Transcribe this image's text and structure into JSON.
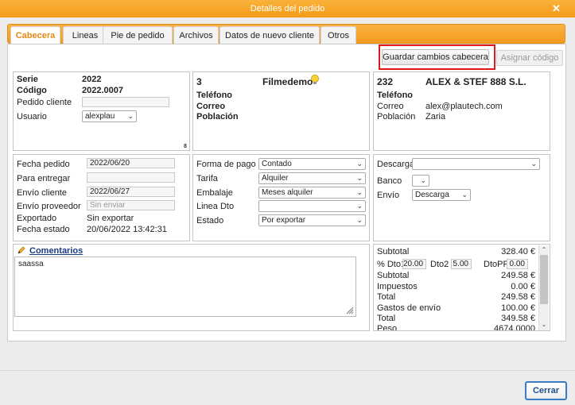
{
  "window": {
    "title": "Detalles del pedido"
  },
  "tabs": [
    {
      "label": "Cabecera"
    },
    {
      "label": "Lineas"
    },
    {
      "label": "Pie de pedido"
    },
    {
      "label": "Archivos"
    },
    {
      "label": "Datos de nuevo cliente"
    },
    {
      "label": "Otros"
    }
  ],
  "toolbar": {
    "save_label": "Guardar cambios cabecera",
    "assign_label": "Asignar código"
  },
  "header": {
    "serie_label": "Serie",
    "serie_value": "2022",
    "codigo_label": "Código",
    "codigo_value": "2022.0007",
    "pedido_cliente_label": "Pedido cliente",
    "pedido_cliente_value": "",
    "usuario_label": "Usuario",
    "usuario_value": "alexplau",
    "corner_num": "8"
  },
  "store": {
    "num": "3",
    "name": "Filmedemo",
    "telefono_label": "Teléfono",
    "correo_label": "Correo",
    "poblacion_label": "Población"
  },
  "customer": {
    "num": "232",
    "name": "ALEX & STEF 888 S.L.",
    "telefono_label": "Teléfono",
    "telefono_value": "",
    "correo_label": "Correo",
    "correo_value": "alex@plautech.com",
    "poblacion_label": "Población",
    "poblacion_value": "Zaria"
  },
  "dates": {
    "fecha_pedido_label": "Fecha pedido",
    "fecha_pedido_value": "2022/06/20",
    "para_entregar_label": "Para entregar",
    "para_entregar_value": "",
    "envio_cliente_label": "Envío cliente",
    "envio_cliente_value": "2022/06/27",
    "envio_proveedor_label": "Envío proveedor",
    "envio_proveedor_placeholder": "Sin enviar",
    "exportado_label": "Exportado",
    "exportado_value": "Sin exportar",
    "fecha_estado_label": "Fecha estado",
    "fecha_estado_value": "20/06/2022 13:42:31"
  },
  "payment": {
    "forma_pago_label": "Forma de pago",
    "forma_pago_value": "Contado",
    "tarifa_label": "Tarifa",
    "tarifa_value": "Alquiler",
    "embalaje_label": "Embalaje",
    "embalaje_value": "Meses alquiler",
    "linea_dto_label": "Linea Dto",
    "linea_dto_value": "",
    "estado_label": "Estado",
    "estado_value": "Por exportar"
  },
  "shipping": {
    "descarga_label": "Descarga",
    "descarga_value": "",
    "banco_label": "Banco",
    "banco_value": "",
    "envio_label": "Envío",
    "envio_value": "Descarga"
  },
  "comments": {
    "link_label": "Comentarios",
    "text": "saassa"
  },
  "totals": {
    "subtotal_label": "Subtotal",
    "subtotal_value": "328.40 €",
    "dto1_label": "% Dto1",
    "dto1_value": "20.00",
    "dto2_label": "Dto2",
    "dto2_value": "5.00",
    "dtopp_label": "DtoPP",
    "dtopp_value": "0.00",
    "subtotal2_label": "Subtotal",
    "subtotal2_value": "249.58 €",
    "impuestos_label": "Impuestos",
    "impuestos_value": "0.00 €",
    "total_label": "Total",
    "total_value": "249.58 €",
    "gastos_label": "Gastos de envío",
    "gastos_value": "100.00 €",
    "total2_label": "Total",
    "total2_value": "349.58 €",
    "peso_label": "Peso",
    "peso_value": "4674.0000"
  },
  "footer": {
    "close_label": "Cerrar"
  },
  "colors": {
    "accent": "#f39c1a",
    "active_tab_text": "#e58a12",
    "highlight_box": "#e01818",
    "close_button_border": "#3a7cc4"
  }
}
